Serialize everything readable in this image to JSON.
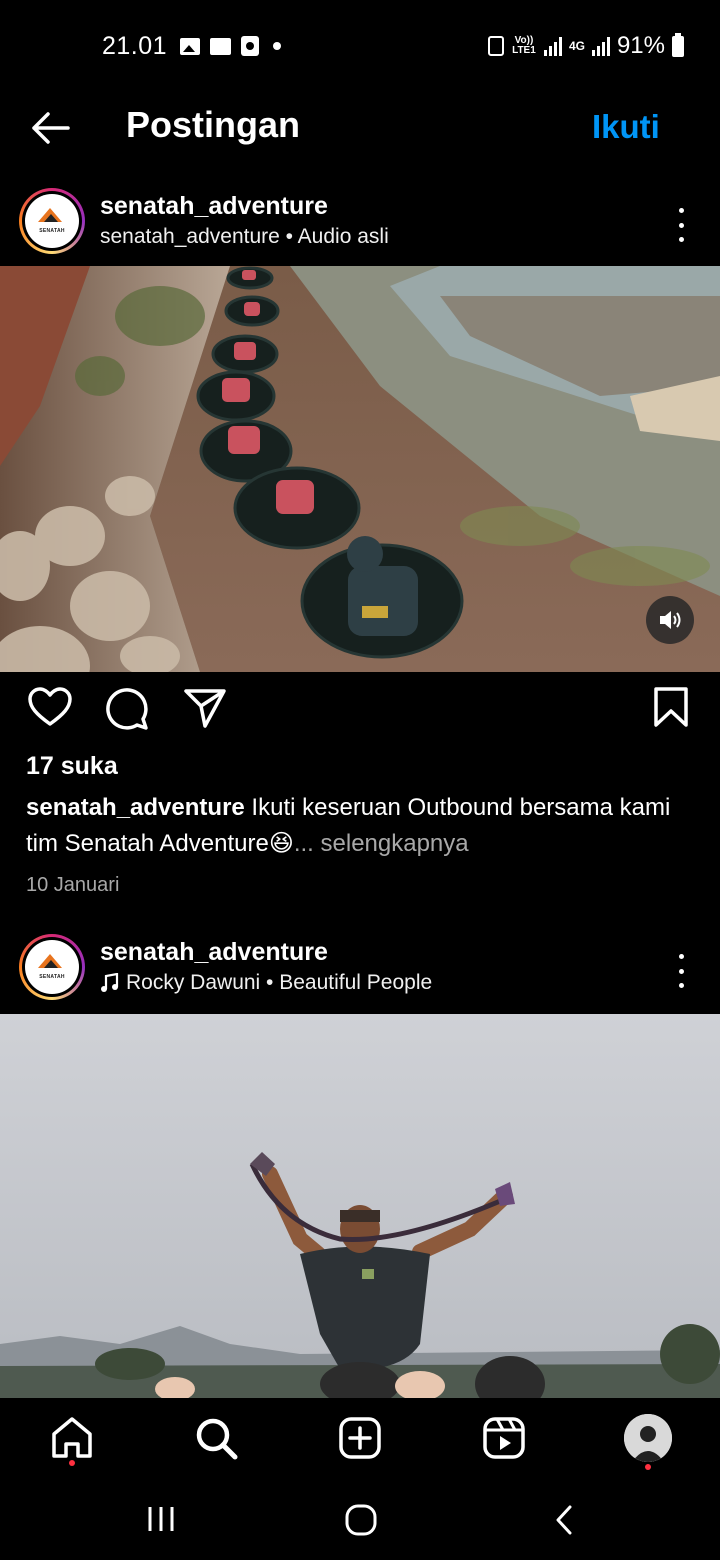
{
  "status_bar": {
    "time": "21.01",
    "volte_label": "Vo)) LTE1",
    "network_label": "4G",
    "battery": "91%"
  },
  "header": {
    "title": "Postingan",
    "follow_label": "Ikuti",
    "back_icon": "arrow-left-icon"
  },
  "posts": [
    {
      "username": "senatah_adventure",
      "subtitle": "senatah_adventure • Audio asli",
      "avatar_text": "SENATAH",
      "likes": "17 suka",
      "caption_user": "senatah_adventure",
      "caption_text": " Ikuti keseruan Outbound bersama kami tim Senatah Adventure😆",
      "caption_more": "... selengkapnya",
      "date": "10 Januari"
    },
    {
      "username": "senatah_adventure",
      "subtitle": "Rocky Dawuni • Beautiful People",
      "avatar_text": "SENATAH"
    }
  ],
  "actions": {
    "like_icon": "heart-icon",
    "comment_icon": "comment-icon",
    "share_icon": "send-icon",
    "save_icon": "bookmark-icon"
  },
  "bottom_nav": [
    "home-icon",
    "search-icon",
    "create-icon",
    "reels-icon",
    "profile-icon"
  ],
  "colors": {
    "accent": "#0095f6",
    "background": "#000000",
    "notification": "#ff3040"
  }
}
